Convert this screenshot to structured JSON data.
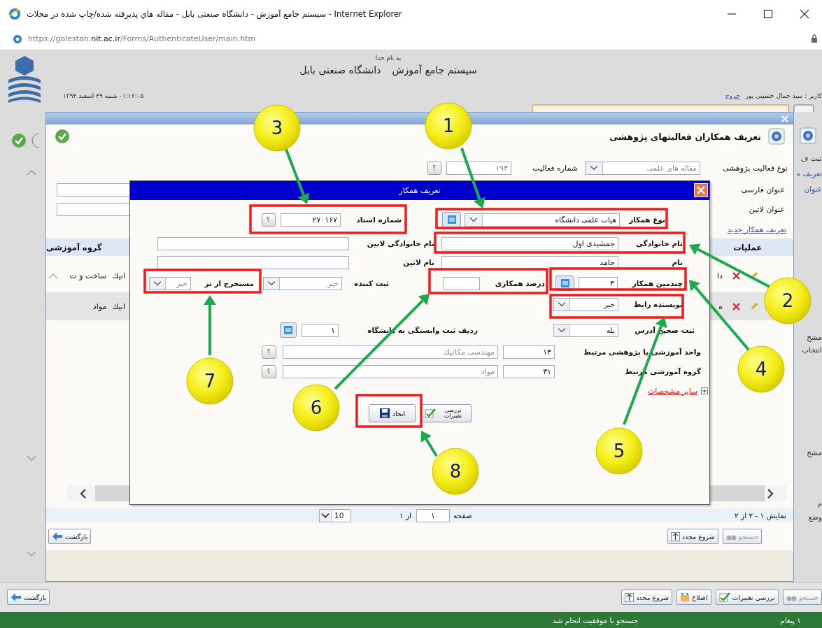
{
  "browser": {
    "title": "سیستم جامع آموزش - دانشگاه صنعتی بابل - مقاله هاي پذيرفته شده/چاپ شده در مجلات - Internet Explorer",
    "url": "https://golestan.**nit.ac.ir**/Forms/AuthenticateUser/main.htm"
  },
  "header": {
    "greeting": "به نام خدا",
    "system": "سیستم جامع آموزش",
    "university": "دانشگاه صنعتی بابل",
    "datetime": "۰۱:۱۶:۰۵ شنبه ۲۹ اسفند ۱۳۹۴",
    "user": "کاربر : سید جمال حسینی پور",
    "logout": "خروج"
  },
  "side_strip": [
    "ثبت ف",
    "تعریف ه",
    "عنوان",
    "مشخ",
    "انتخاب",
    "مشخ",
    "م",
    "وضع"
  ],
  "form": {
    "title": "تعریف همکاران فعالیتهای پژوهشی",
    "activity_type_label": "نوع فعالیت پژوهشی",
    "activity_type": "مقاله های علمی",
    "activity_no_label": "شماره فعالیت",
    "activity_no": "۱۹۳",
    "lookup": "؟",
    "title_fa_label": "عنوان فارسی",
    "title_en_label": "عنوان لاتین",
    "new_link": "تعریف همکار جدید",
    "columns": [
      "عملیات",
      "گروه آموزشی"
    ],
    "rows": [
      {
        "operation": "دا",
        "cells": [
          "انیك",
          "ساخت و ت"
        ]
      },
      {
        "operation": "ه",
        "cells": [
          "انیك",
          "مواد"
        ]
      }
    ],
    "pager": {
      "summary": "نمایش ۱ - ۲ از ۲",
      "page_label": "صفحه",
      "page": "۱",
      "of": "از ۱",
      "page_size": "10"
    },
    "buttons": [
      {
        "label": "جستجو",
        "kind": "search",
        "disabled": true
      },
      {
        "label": "شروع مجدد",
        "kind": "restart",
        "disabled": false
      },
      {
        "label": "بازگشت",
        "kind": "back",
        "disabled": false
      }
    ]
  },
  "dialog": {
    "title": "تعریف همکار",
    "coworker_type": {
      "label": "نوع همکار",
      "value": "هیات علمی دانشگاه"
    },
    "professor_no": {
      "label": "شماره استاد",
      "value": "۲۷۰۱۶۷",
      "lookup": "؟"
    },
    "last_name": {
      "label": "نام خانوادگی",
      "value": "جمشیدی اول"
    },
    "last_name_latin": {
      "label": "نام خانوادگی لاتین"
    },
    "first_name": {
      "label": "نام",
      "value": "حامد"
    },
    "first_name_latin": {
      "label": "نام لاتین"
    },
    "coworker_order": {
      "label": "چندمین همکار",
      "value": "۳"
    },
    "share_percent": {
      "label": "درصد همکاری"
    },
    "registrar": {
      "label": "ثبت کننده",
      "value": "خیر"
    },
    "from_thesis": {
      "label": "مستخرج از تز",
      "value": "خیر"
    },
    "corresponding_author": {
      "label": "نویسنده رابط",
      "value": "خیر"
    },
    "address_correct": {
      "label": "ثبت صحیح آدرس",
      "value": "بله"
    },
    "affiliation_row": {
      "label": "ردیف ثبت وابستگی به دانشگاه",
      "value": "۱"
    },
    "unit": {
      "label": "واحد آموزشی یا پژوهشی مرتبط",
      "code": "۱۳",
      "name": "مهندسی مکانیك",
      "lookup": "؟"
    },
    "group": {
      "label": "گروه آموزشی مرتبط",
      "code": "۳۱",
      "name": "مواد",
      "lookup": "؟"
    },
    "more_link": "سایر مشخصات",
    "create_button": "ایجاد",
    "check_button": "بررسی تغییرات"
  },
  "bottom_buttons": [
    {
      "label": "جستجو",
      "kind": "search",
      "disabled": true
    },
    {
      "label": "بررسی تغییرات",
      "kind": "check",
      "disabled": false
    },
    {
      "label": "اصلاح",
      "kind": "edit",
      "disabled": false
    },
    {
      "label": "شروع مجدد",
      "kind": "restart",
      "disabled": false
    },
    {
      "label": "بازگشت",
      "kind": "back",
      "disabled": false
    }
  ],
  "status": {
    "messages": "۱ پیغام",
    "text": "جستجو با موفقیت انجام شد"
  },
  "callouts": [
    "1",
    "2",
    "3",
    "4",
    "5",
    "6",
    "7",
    "8"
  ]
}
